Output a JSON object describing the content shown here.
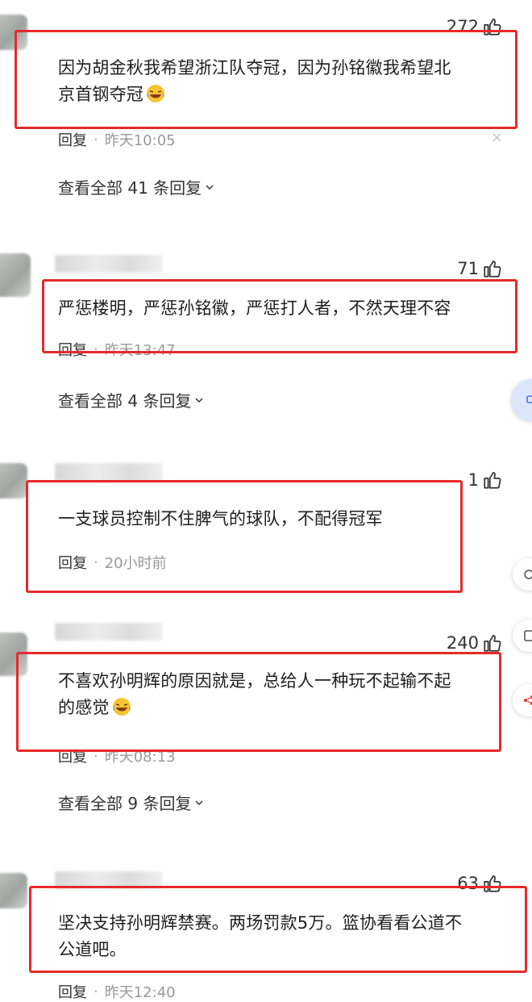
{
  "comments": [
    {
      "likes": "272",
      "text_line1": "因为胡金秋我希望浙江队夺冠，因为孙铭徽我希望北",
      "text_line2": "京首钢夺冠",
      "reply_label": "回复",
      "time": "昨天10:05",
      "view_replies": "查看全部 41 条回复"
    },
    {
      "likes": "71",
      "text_line1": "严惩楼明，严惩孙铭徽，严惩打人者，不然天理不容",
      "reply_label": "回复",
      "time": "昨天13:47",
      "view_replies": "查看全部 4 条回复"
    },
    {
      "likes": "1",
      "text_line1": "一支球员控制不住脾气的球队，不配得冠军",
      "reply_label": "回复",
      "time": "20小时前"
    },
    {
      "likes": "240",
      "text_line1": "不喜欢孙明辉的原因就是，总给人一种玩不起输不起",
      "text_line2": "的感觉",
      "reply_label": "回复",
      "time": "昨天08:13",
      "view_replies": "查看全部 9 条回复"
    },
    {
      "likes": "63",
      "text_line1": "坚决支持孙明辉禁赛。两场罚款5万。篮协看看公道不",
      "text_line2": "公道吧。",
      "reply_label": "回复",
      "time": "昨天12:40"
    }
  ],
  "icons": {
    "like": "thumbs-up-icon",
    "emoji": "laughing-crying-emoji-icon",
    "chevron": "chevron-down-icon",
    "close": "close-icon"
  },
  "colors": {
    "highlight_box": "#e62a2a",
    "side_button": "#4a74d8"
  },
  "glyphs": {
    "close": "×",
    "dot": "·"
  }
}
